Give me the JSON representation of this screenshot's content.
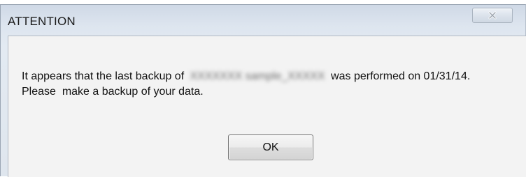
{
  "dialog": {
    "title": "ATTENTION",
    "close_icon": "close-icon",
    "message": {
      "line1_prefix": "It appears that the last backup of",
      "redacted_name": "XXXXXXX sample_XXXXX",
      "line1_suffix": "was performed on 01/31/14.",
      "line2": "Please  make a backup of your data."
    },
    "ok_label": "OK"
  }
}
